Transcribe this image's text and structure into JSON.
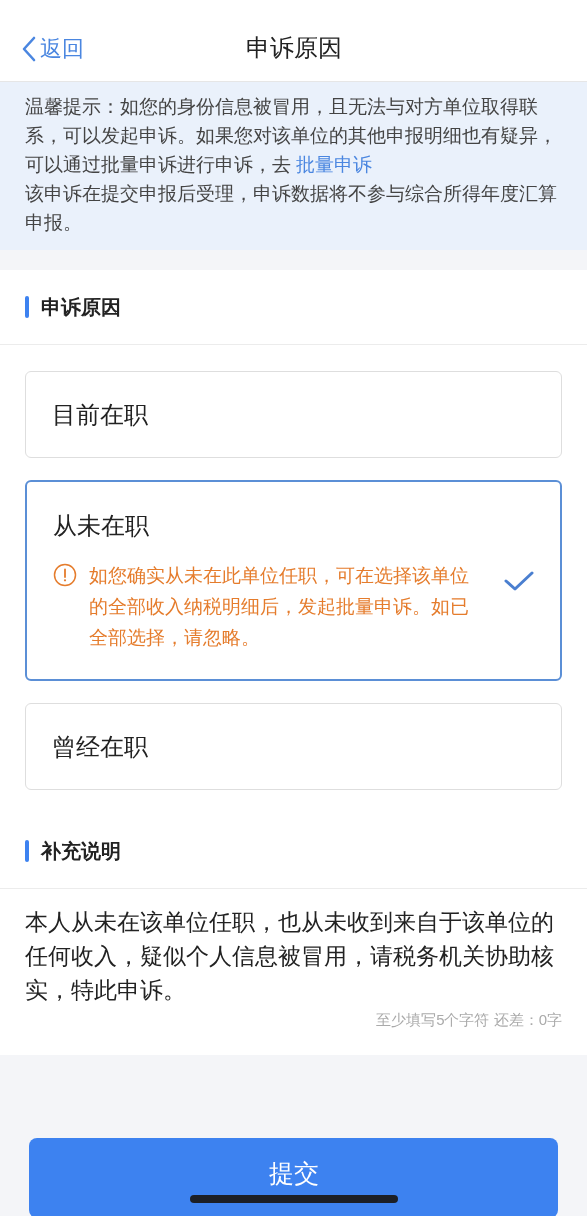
{
  "nav": {
    "back": "返回",
    "title": "申诉原因"
  },
  "notice": {
    "text": "温馨提示：如您的身份信息被冒用，且无法与对方单位取得联系，可以发起申诉。如果您对该单位的其他申报明细也有疑异，可以通过批量申诉进行申诉，去 ",
    "link": "批量申诉",
    "text2": "该申诉在提交申报后受理，申诉数据将不参与综合所得年度汇算申报。"
  },
  "reason_section": {
    "title": "申诉原因"
  },
  "options": [
    {
      "label": "目前在职",
      "selected": false
    },
    {
      "label": "从未在职",
      "selected": true,
      "note": "如您确实从未在此单位任职，可在选择该单位的全部收入纳税明细后，发起批量申诉。如已全部选择，请忽略。"
    },
    {
      "label": "曾经在职",
      "selected": false
    }
  ],
  "remark_section": {
    "title": "补充说明"
  },
  "remark": {
    "value": "本人从未在该单位任职，也从未收到来自于该单位的任何收入，疑似个人信息被冒用，请税务机关协助核实，特此申诉。",
    "counter": "至少填写5个字符 还差：0字"
  },
  "submit": "提交"
}
